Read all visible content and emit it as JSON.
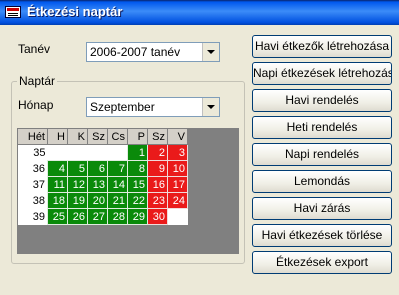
{
  "window": {
    "title": "Étkezési naptár",
    "icon": "calendar-app-icon"
  },
  "form": {
    "tanev_label": "Tanév",
    "tanev_value": "2006-2007 tanév",
    "naptar_label": "Naptár",
    "honap_label": "Hónap",
    "honap_value": "Szeptember"
  },
  "calendar": {
    "headers": [
      "Hét",
      "H",
      "K",
      "Sz",
      "Cs",
      "P",
      "Sz",
      "V"
    ],
    "rows": [
      {
        "week": "35",
        "days": [
          "",
          "",
          "",
          "",
          "1",
          "2",
          "3"
        ],
        "kinds": [
          "w",
          "w",
          "w",
          "w",
          "g",
          "r",
          "r"
        ]
      },
      {
        "week": "36",
        "days": [
          "4",
          "5",
          "6",
          "7",
          "8",
          "9",
          "10"
        ],
        "kinds": [
          "g",
          "g",
          "g",
          "g",
          "g",
          "r",
          "r"
        ]
      },
      {
        "week": "37",
        "days": [
          "11",
          "12",
          "13",
          "14",
          "15",
          "16",
          "17"
        ],
        "kinds": [
          "g",
          "g",
          "g",
          "g",
          "g",
          "r",
          "r"
        ]
      },
      {
        "week": "38",
        "days": [
          "18",
          "19",
          "20",
          "21",
          "22",
          "23",
          "24"
        ],
        "kinds": [
          "g",
          "g",
          "g",
          "g",
          "g",
          "r",
          "r"
        ]
      },
      {
        "week": "39",
        "days": [
          "25",
          "26",
          "27",
          "28",
          "29",
          "30",
          ""
        ],
        "kinds": [
          "g",
          "g",
          "g",
          "g",
          "g",
          "r",
          "w"
        ]
      }
    ],
    "colors": {
      "workday": "#0a8a0a",
      "weekend": "#ea1a1a"
    }
  },
  "buttons": [
    "Havi étkezők létrehozása",
    "Napi étkezések létrehozása",
    "Havi rendelés",
    "Heti rendelés",
    "Napi rendelés",
    "Lemondás",
    "Havi zárás",
    "Havi étkezések törlése",
    "Étkezések export"
  ]
}
